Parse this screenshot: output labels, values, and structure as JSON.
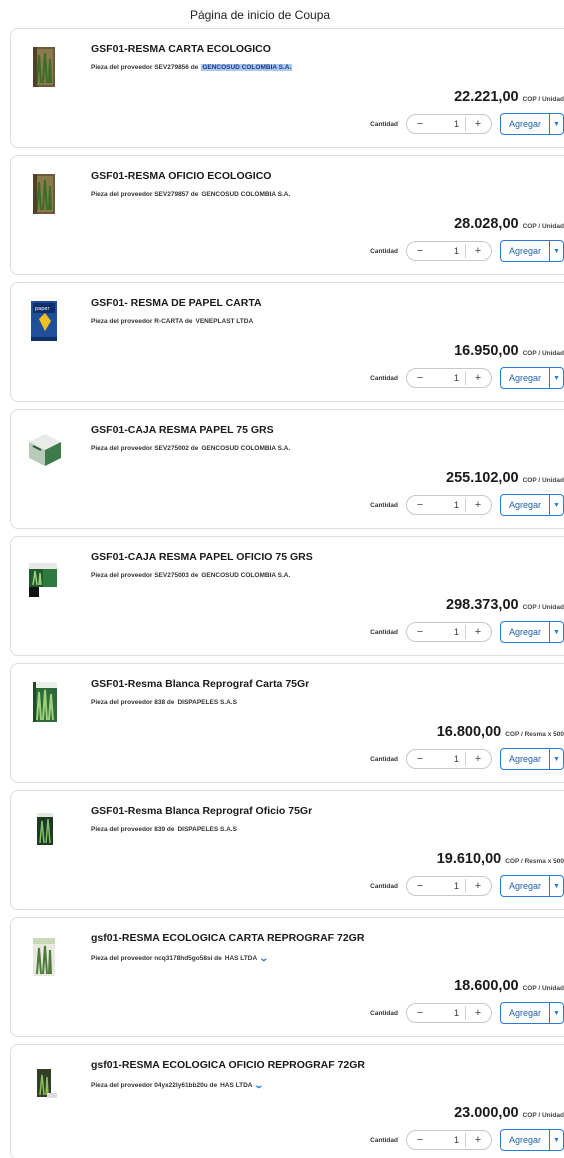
{
  "page_title": "Página de inicio de Coupa",
  "labels": {
    "quantity": "Cantidad",
    "add": "Agregar",
    "minus": "−",
    "plus": "+"
  },
  "colors": {
    "accent": "#2a7bd4",
    "highlight": "#a9c9ef"
  },
  "products": [
    {
      "title": "GSF01-RESMA CARTA ECOLOGICO",
      "supplier_prefix": "Pieza del proveedor SEV279856 de",
      "supplier_name": "GENCOSUD COLOMBIA S.A.",
      "supplier_highlight": true,
      "show_chevron": false,
      "price": "22.221,00",
      "unit": "COP / Unidad",
      "qty": "1",
      "icon": "paper-ream-eco"
    },
    {
      "title": "GSF01-RESMA OFICIO ECOLOGICO",
      "supplier_prefix": "Pieza del proveedor SEV279857 de",
      "supplier_name": "GENCOSUD COLOMBIA S.A.",
      "supplier_highlight": false,
      "show_chevron": false,
      "price": "28.028,00",
      "unit": "COP / Unidad",
      "qty": "1",
      "icon": "paper-ream-eco"
    },
    {
      "title": "GSF01- RESMA DE PAPEL CARTA",
      "supplier_prefix": "Pieza del proveedor R-CARTA de",
      "supplier_name": "VENEPLAST LTDA",
      "supplier_highlight": false,
      "show_chevron": false,
      "price": "16.950,00",
      "unit": "COP / Unidad",
      "qty": "1",
      "icon": "paper-ream-blue"
    },
    {
      "title": "GSF01-CAJA RESMA PAPEL 75 GRS",
      "supplier_prefix": "Pieza del proveedor SEV275002 de",
      "supplier_name": "GENCOSUD COLOMBIA S.A.",
      "supplier_highlight": false,
      "show_chevron": false,
      "price": "255.102,00",
      "unit": "COP / Unidad",
      "qty": "1",
      "icon": "paper-box"
    },
    {
      "title": "GSF01-CAJA RESMA PAPEL OFICIO 75 GRS",
      "supplier_prefix": "Pieza del proveedor SEV275003 de",
      "supplier_name": "GENCOSUD COLOMBIA S.A.",
      "supplier_highlight": false,
      "show_chevron": false,
      "price": "298.373,00",
      "unit": "COP / Unidad",
      "qty": "1",
      "icon": "paper-box-green"
    },
    {
      "title": "GSF01-Resma Blanca Reprograf Carta 75Gr",
      "supplier_prefix": "Pieza del proveedor 838 de",
      "supplier_name": "DISPAPELES S.A.S",
      "supplier_highlight": false,
      "show_chevron": false,
      "price": "16.800,00",
      "unit": "COP / Resma x 500",
      "qty": "1",
      "icon": "paper-ream-green"
    },
    {
      "title": "GSF01-Resma Blanca Reprograf Oficio 75Gr",
      "supplier_prefix": "Pieza del proveedor 839 de",
      "supplier_name": "DISPAPELES S.A.S",
      "supplier_highlight": false,
      "show_chevron": false,
      "price": "19.610,00",
      "unit": "COP / Resma x 500",
      "qty": "1",
      "icon": "paper-ream-dark"
    },
    {
      "title": "gsf01-RESMA ECOLOGICA CARTA REPROGRAF 72GR",
      "supplier_prefix": "Pieza del proveedor ncq3178hd5go58si de",
      "supplier_name": "HAS LTDA",
      "supplier_highlight": false,
      "show_chevron": true,
      "price": "18.600,00",
      "unit": "COP / Unidad",
      "qty": "1",
      "icon": "paper-ream-eco-light"
    },
    {
      "title": "gsf01-RESMA ECOLOGICA OFICIO REPROGRAF 72GR",
      "supplier_prefix": "Pieza del proveedor 04yx22ly61bb20u de",
      "supplier_name": "HAS LTDA",
      "supplier_highlight": false,
      "show_chevron": true,
      "price": "23.000,00",
      "unit": "COP / Unidad",
      "qty": "1",
      "icon": "paper-ream-eco-small"
    }
  ]
}
